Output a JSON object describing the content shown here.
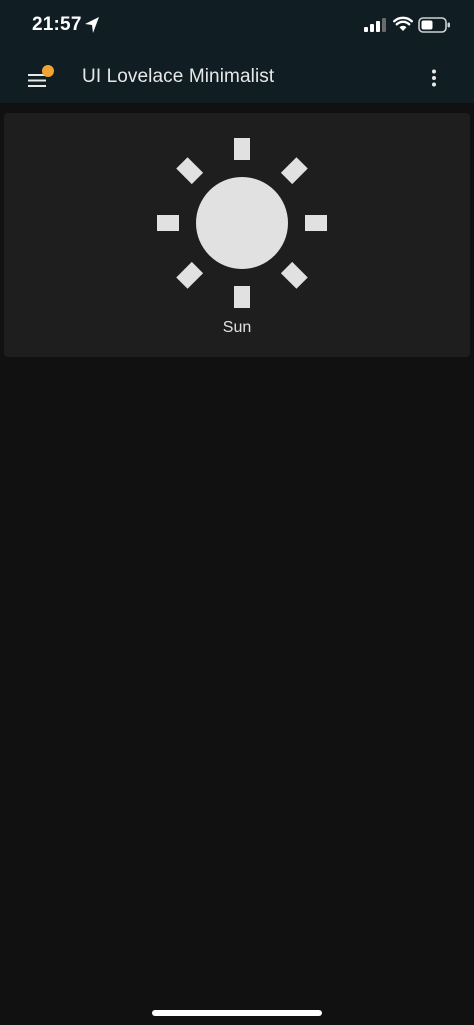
{
  "status_bar": {
    "time": "21:57",
    "icons": [
      "location-arrow-icon",
      "cellular-signal-icon",
      "wifi-icon",
      "battery-icon"
    ]
  },
  "app_bar": {
    "title": "UI Lovelace Minimalist",
    "menu_icon": "hamburger-menu-icon",
    "overflow_icon": "more-vertical-icon",
    "notification_dot_color": "#f0a431"
  },
  "card": {
    "icon": "sun-icon",
    "label": "Sun"
  },
  "colors": {
    "header_bg": "#101e24",
    "page_bg": "#111111",
    "card_bg": "#1e1e1e",
    "icon": "#e1e1e1"
  }
}
